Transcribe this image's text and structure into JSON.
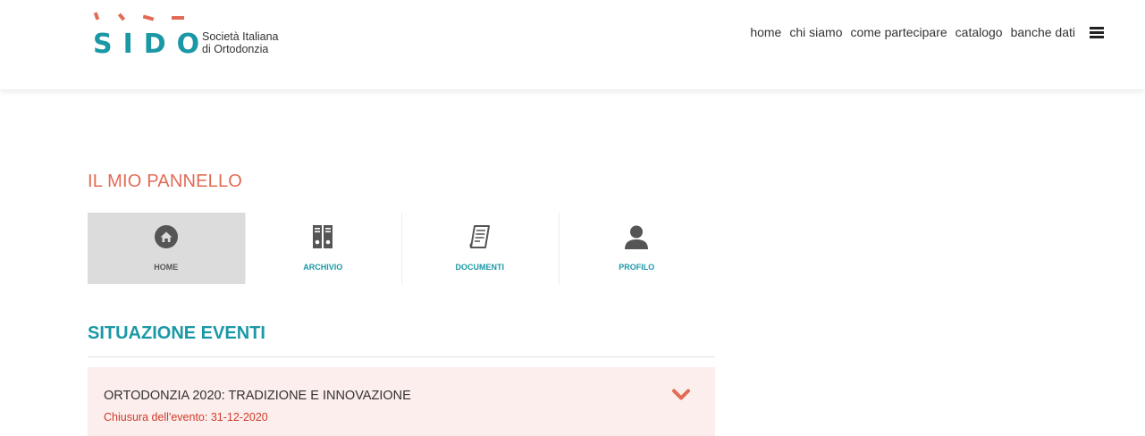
{
  "header": {
    "logo": {
      "mark": "SIDO",
      "subtitle_line1": "Società Italiana",
      "subtitle_line2": "di Ortodonzia"
    },
    "nav": [
      {
        "label": "home"
      },
      {
        "label": "chi siamo"
      },
      {
        "label": "come partecipare"
      },
      {
        "label": "catalogo"
      },
      {
        "label": "banche dati"
      }
    ],
    "menu_icon": "hamburger-icon"
  },
  "panel": {
    "title": "IL MIO PANNELLO",
    "tiles": [
      {
        "label": "HOME",
        "icon": "home-icon",
        "active": true
      },
      {
        "label": "ARCHIVIO",
        "icon": "archive-binders-icon",
        "active": false
      },
      {
        "label": "DOCUMENTI",
        "icon": "document-icon",
        "active": false
      },
      {
        "label": "PROFILO",
        "icon": "user-icon",
        "active": false
      }
    ]
  },
  "events": {
    "title": "SITUAZIONE EVENTI",
    "items": [
      {
        "title": "ORTODONZIA 2020: TRADIZIONE E INNOVAZIONE",
        "closing": "Chiusura dell'evento: 31-12-2020",
        "icon": "chevron-down-icon"
      }
    ]
  },
  "colors": {
    "brand_teal": "#1b98a6",
    "accent_coral": "#e26b55",
    "event_bg": "#fbeeec",
    "alert_red": "#d23a2a"
  }
}
